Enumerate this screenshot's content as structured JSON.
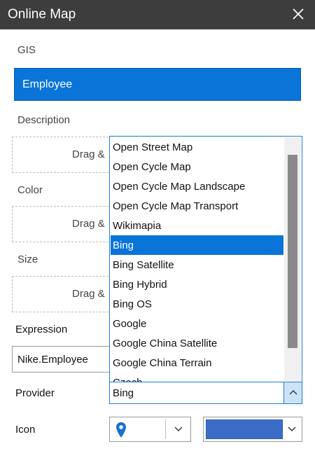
{
  "window": {
    "title": "Online Map"
  },
  "fields": {
    "gis_label": "GIS",
    "gis_value": "Employee",
    "description_label": "Description",
    "color_label": "Color",
    "size_label": "Size",
    "expression_label": "Expression",
    "expression_value": "Nike.Employee",
    "provider_label": "Provider",
    "provider_value": "Bing",
    "icon_label": "Icon",
    "drop_hint": "Drag & ",
    "icon_color": "#3b6dc8"
  },
  "provider_options": [
    "Open Street Map",
    "Open Cycle Map",
    "Open Cycle Map Landscape",
    "Open Cycle Map Transport",
    "Wikimapia",
    "Bing",
    "Bing Satellite",
    "Bing Hybrid",
    "Bing OS",
    "Google",
    "Google China Satellite",
    "Google China Terrain",
    "Czech"
  ],
  "selected_option": "Bing"
}
